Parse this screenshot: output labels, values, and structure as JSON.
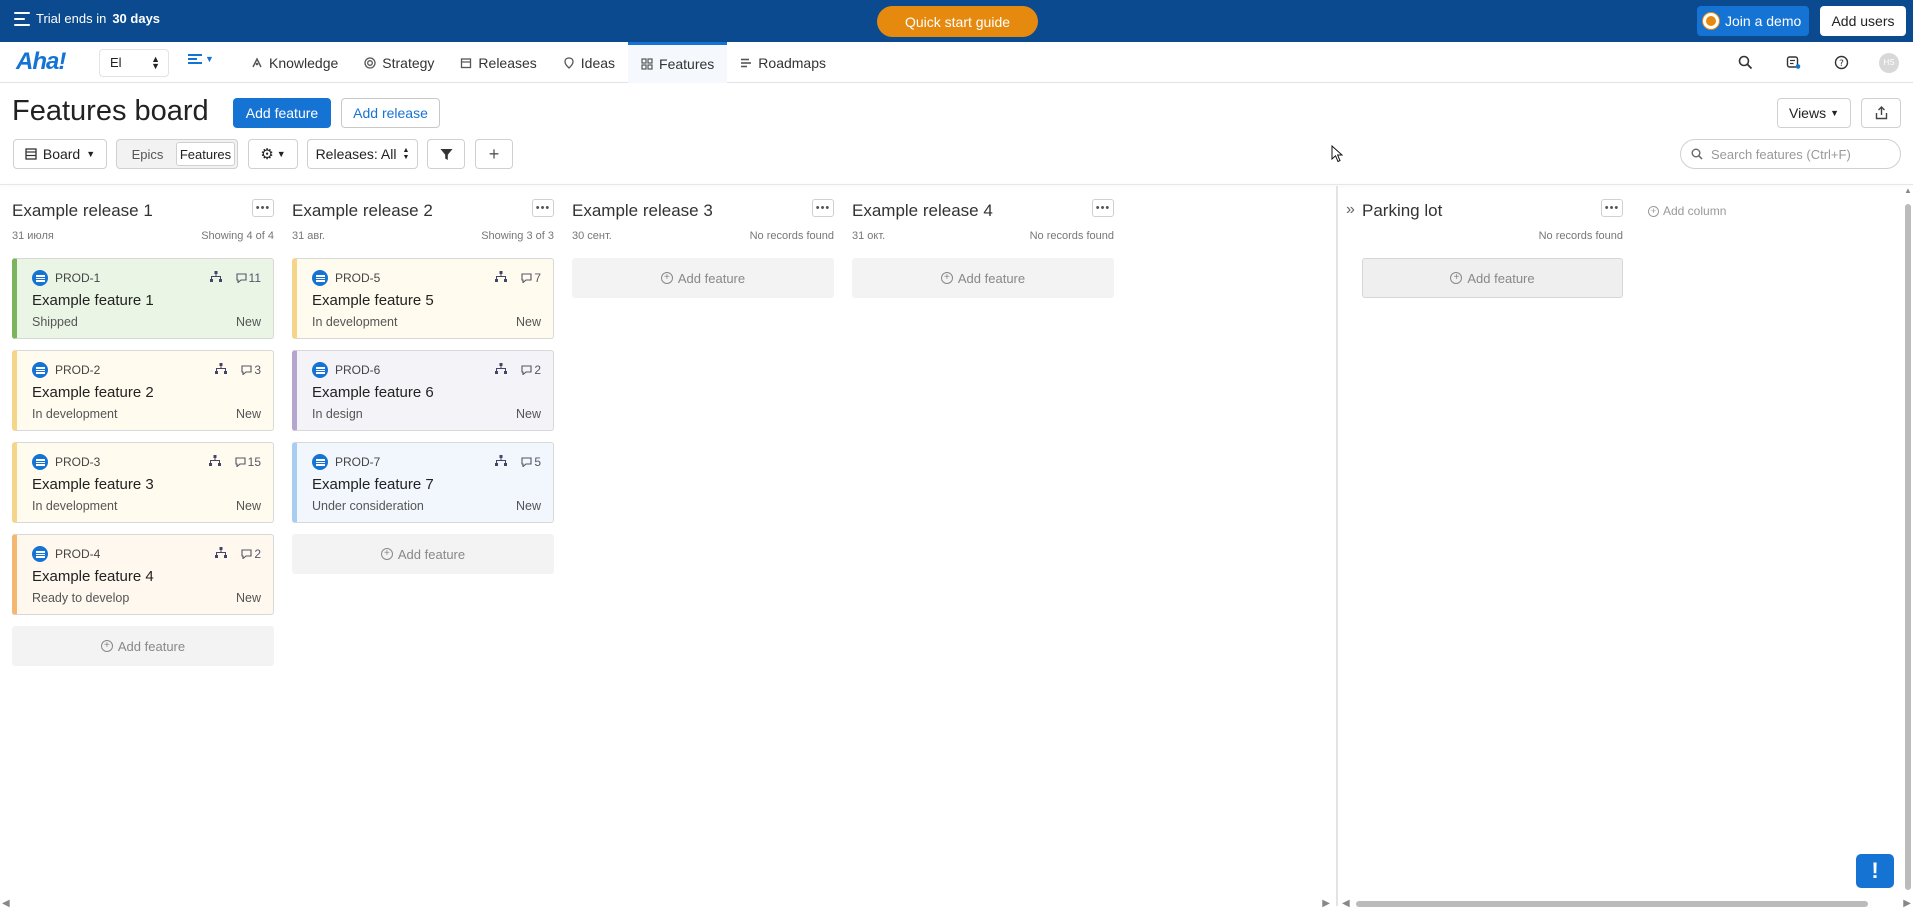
{
  "trialbar": {
    "text_prefix": "Trial ends in",
    "days": "30 days",
    "quick_start": "Quick start guide",
    "join_demo": "Join a demo",
    "add_users": "Add users"
  },
  "nav": {
    "logo": "Aha!",
    "workspace": "El",
    "items": [
      {
        "label": "Knowledge",
        "icon": "knowledge-icon"
      },
      {
        "label": "Strategy",
        "icon": "strategy-icon"
      },
      {
        "label": "Releases",
        "icon": "releases-icon"
      },
      {
        "label": "Ideas",
        "icon": "ideas-icon"
      },
      {
        "label": "Features",
        "icon": "features-icon",
        "active": true
      },
      {
        "label": "Roadmaps",
        "icon": "roadmaps-icon"
      }
    ],
    "avatar_initials": "HS"
  },
  "header": {
    "title": "Features board",
    "add_feature": "Add feature",
    "add_release": "Add release",
    "views": "Views"
  },
  "toolbar": {
    "board": "Board",
    "epics": "Epics",
    "features": "Features",
    "releases_filter": "Releases: All",
    "search_placeholder": "Search features (Ctrl+F)"
  },
  "board": {
    "add_feature": "Add feature",
    "add_column": "Add column",
    "columns": [
      {
        "title": "Example release 1",
        "date": "31 июля",
        "count": "Showing 4 of 4",
        "cards": [
          {
            "id": "PROD-1",
            "name": "Example feature 1",
            "status": "Shipped",
            "tag": "New",
            "comments": "11"
          },
          {
            "id": "PROD-2",
            "name": "Example feature 2",
            "status": "In development",
            "tag": "New",
            "comments": "3"
          },
          {
            "id": "PROD-3",
            "name": "Example feature 3",
            "status": "In development",
            "tag": "New",
            "comments": "15"
          },
          {
            "id": "PROD-4",
            "name": "Example feature 4",
            "status": "Ready to develop",
            "tag": "New",
            "comments": "2"
          }
        ]
      },
      {
        "title": "Example release 2",
        "date": "31 авг.",
        "count": "Showing 3 of 3",
        "cards": [
          {
            "id": "PROD-5",
            "name": "Example feature 5",
            "status": "In development",
            "tag": "New",
            "comments": "7"
          },
          {
            "id": "PROD-6",
            "name": "Example feature 6",
            "status": "In design",
            "tag": "New",
            "comments": "2"
          },
          {
            "id": "PROD-7",
            "name": "Example feature 7",
            "status": "Under consideration",
            "tag": "New",
            "comments": "5"
          }
        ]
      },
      {
        "title": "Example release 3",
        "date": "30 сент.",
        "count": "No records found",
        "cards": []
      },
      {
        "title": "Example release 4",
        "date": "31 окт.",
        "count": "No records found",
        "cards": []
      }
    ],
    "parking": {
      "title": "Parking lot",
      "count": "No records found"
    }
  },
  "help_fab": "!"
}
